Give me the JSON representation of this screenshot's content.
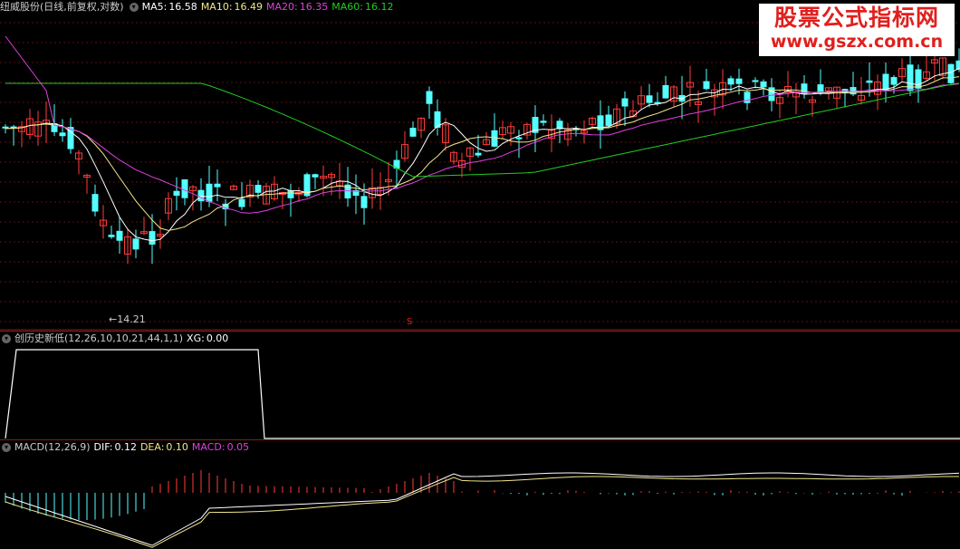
{
  "main": {
    "stock_name": "纽威股份(日线,前复权,对数)",
    "ma5": {
      "label": "MA5:",
      "value": "16.58",
      "color": "#ffffff"
    },
    "ma10": {
      "label": "MA10:",
      "value": "16.49",
      "color": "#f0e68c"
    },
    "ma20": {
      "label": "MA20:",
      "value": "16.35",
      "color": "#e040e0"
    },
    "ma60": {
      "label": "MA60:",
      "value": "16.12",
      "color": "#22cc22"
    },
    "low_label": "14.21",
    "signal_marker": "S",
    "up_color": "#ff3b3b",
    "down_color": "#54ffff"
  },
  "xg": {
    "title": "创历史新低(12,26,10,10,21,44,1,1)",
    "xg_label": "XG:",
    "xg_value": "0.00"
  },
  "macd": {
    "title": "MACD(12,26,9)",
    "dif_label": "DIF:",
    "dif_value": "0.12",
    "dea_label": "DEA:",
    "dea_value": "0.10",
    "macd_label": "MACD:",
    "macd_value": "0.05"
  },
  "watermark": {
    "title": "股票公式指标网",
    "url": "www.gszx.com.cn"
  }
}
